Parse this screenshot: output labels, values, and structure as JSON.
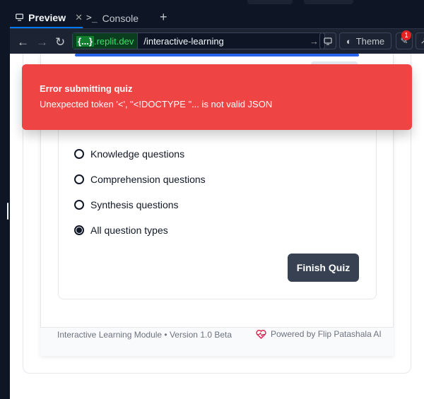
{
  "tabs": {
    "preview_label": "Preview",
    "console_label": "Console",
    "add_label": "+"
  },
  "urlbar": {
    "host_prefix": "{...}",
    "host_suffix": ".replit.dev",
    "path": "/interactive-learning",
    "theme_label": "Theme",
    "notification_count": "1"
  },
  "toast": {
    "title": "Error submitting quiz",
    "message": "Unexpected token '<', \"<!DOCTYPE \"... is not valid JSON"
  },
  "quiz": {
    "options": [
      {
        "label": "Knowledge questions",
        "selected": false
      },
      {
        "label": "Comprehension questions",
        "selected": false
      },
      {
        "label": "Synthesis questions",
        "selected": false
      },
      {
        "label": "All question types",
        "selected": true
      }
    ],
    "finish_label": "Finish Quiz"
  },
  "footer": {
    "left_text": "Interactive Learning Module • Version 1.0 Beta",
    "right_text": "Powered by Flip Patashala AI"
  },
  "colors": {
    "toast_bg": "#ef4444",
    "primary_button": "#374151",
    "progress": "#2563eb",
    "ide_bg": "#0e1525"
  }
}
